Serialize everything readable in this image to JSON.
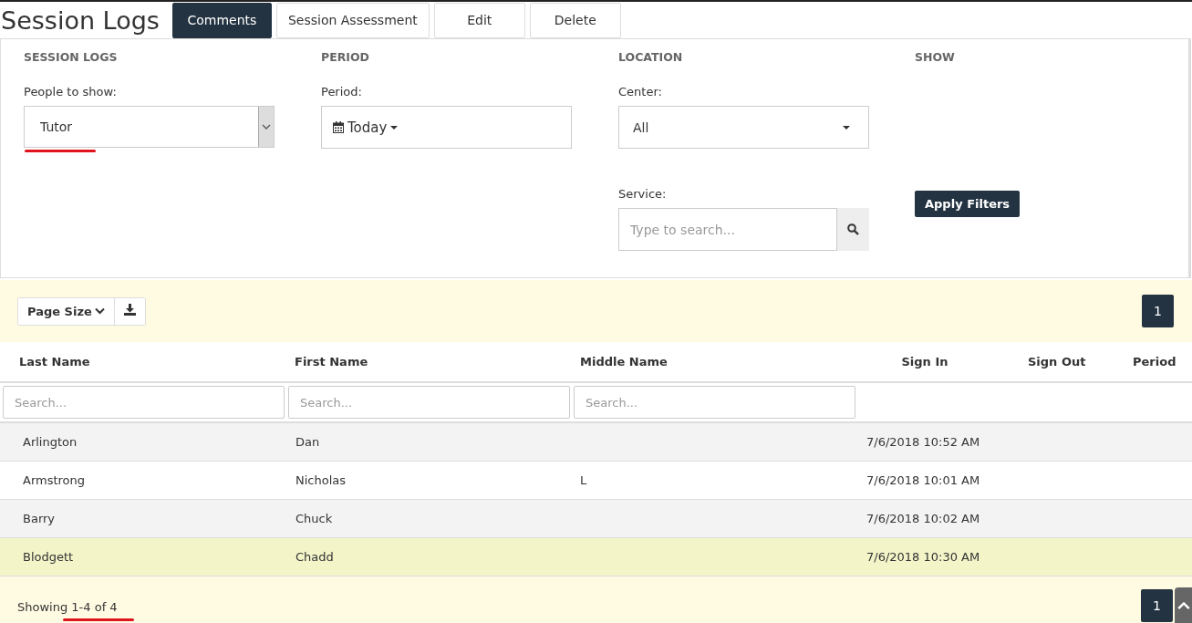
{
  "page_title": "Session Logs",
  "actions": [
    {
      "label": "Comments",
      "selected": true
    },
    {
      "label": "Session Assessment",
      "selected": false
    },
    {
      "label": "Edit",
      "selected": false
    },
    {
      "label": "Delete",
      "selected": false
    }
  ],
  "filters": {
    "sections": [
      "SESSION LOGS",
      "PERIOD",
      "LOCATION",
      "SHOW"
    ],
    "people": {
      "label": "People to show:",
      "value": "Tutor",
      "annotated": true
    },
    "period": {
      "label": "Period:",
      "value": "Today"
    },
    "center": {
      "label": "Center:",
      "value": "All"
    },
    "service": {
      "label": "Service:",
      "placeholder": "Type to search..."
    },
    "apply_button": "Apply Filters"
  },
  "toolbar": {
    "page_size": "Page Size",
    "page": "1"
  },
  "table": {
    "columns": [
      "Last Name",
      "First Name",
      "Middle Name",
      "Sign In",
      "Sign Out",
      "Period"
    ],
    "search_placeholders": [
      "Search...",
      "Search...",
      "Search..."
    ],
    "rows": [
      {
        "cells": [
          "Arlington",
          "Dan",
          "",
          "7/6/2018 10:52 AM",
          "",
          ""
        ],
        "selected": false
      },
      {
        "cells": [
          "Armstrong",
          "Nicholas",
          "L",
          "7/6/2018 10:01 AM",
          "",
          ""
        ],
        "selected": false
      },
      {
        "cells": [
          "Barry",
          "Chuck",
          "",
          "7/6/2018 10:02 AM",
          "",
          ""
        ],
        "selected": false
      },
      {
        "cells": [
          "Blodgett",
          "Chadd",
          "",
          "7/6/2018 10:30 AM",
          "",
          ""
        ],
        "selected": true
      }
    ]
  },
  "footer": {
    "prefix": "Showing",
    "range": "1-4 of 4",
    "annotated": true,
    "page": "1"
  }
}
